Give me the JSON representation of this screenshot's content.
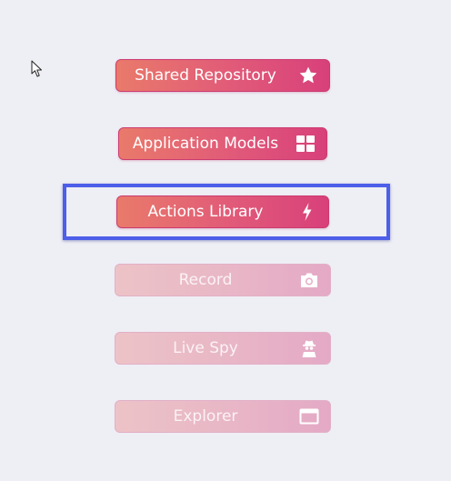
{
  "buttons": [
    {
      "label": "Shared Repository",
      "icon": "star-icon",
      "state": "enabled"
    },
    {
      "label": "Application Models",
      "icon": "grid-icon",
      "state": "enabled"
    },
    {
      "label": "Actions Library",
      "icon": "lightning-icon",
      "state": "enabled",
      "focused": true
    },
    {
      "label": "Record",
      "icon": "camera-icon",
      "state": "disabled"
    },
    {
      "label": "Live Spy",
      "icon": "spy-icon",
      "state": "disabled"
    },
    {
      "label": "Explorer",
      "icon": "window-icon",
      "state": "disabled"
    }
  ],
  "colors": {
    "background": "#eeeef5",
    "button_gradient_start": "#e97a6a",
    "button_gradient_end": "#d8407a",
    "disabled_gradient_start": "#ecc3c7",
    "disabled_gradient_end": "#e4a9c6",
    "focus_ring": "#4d5ee8"
  }
}
